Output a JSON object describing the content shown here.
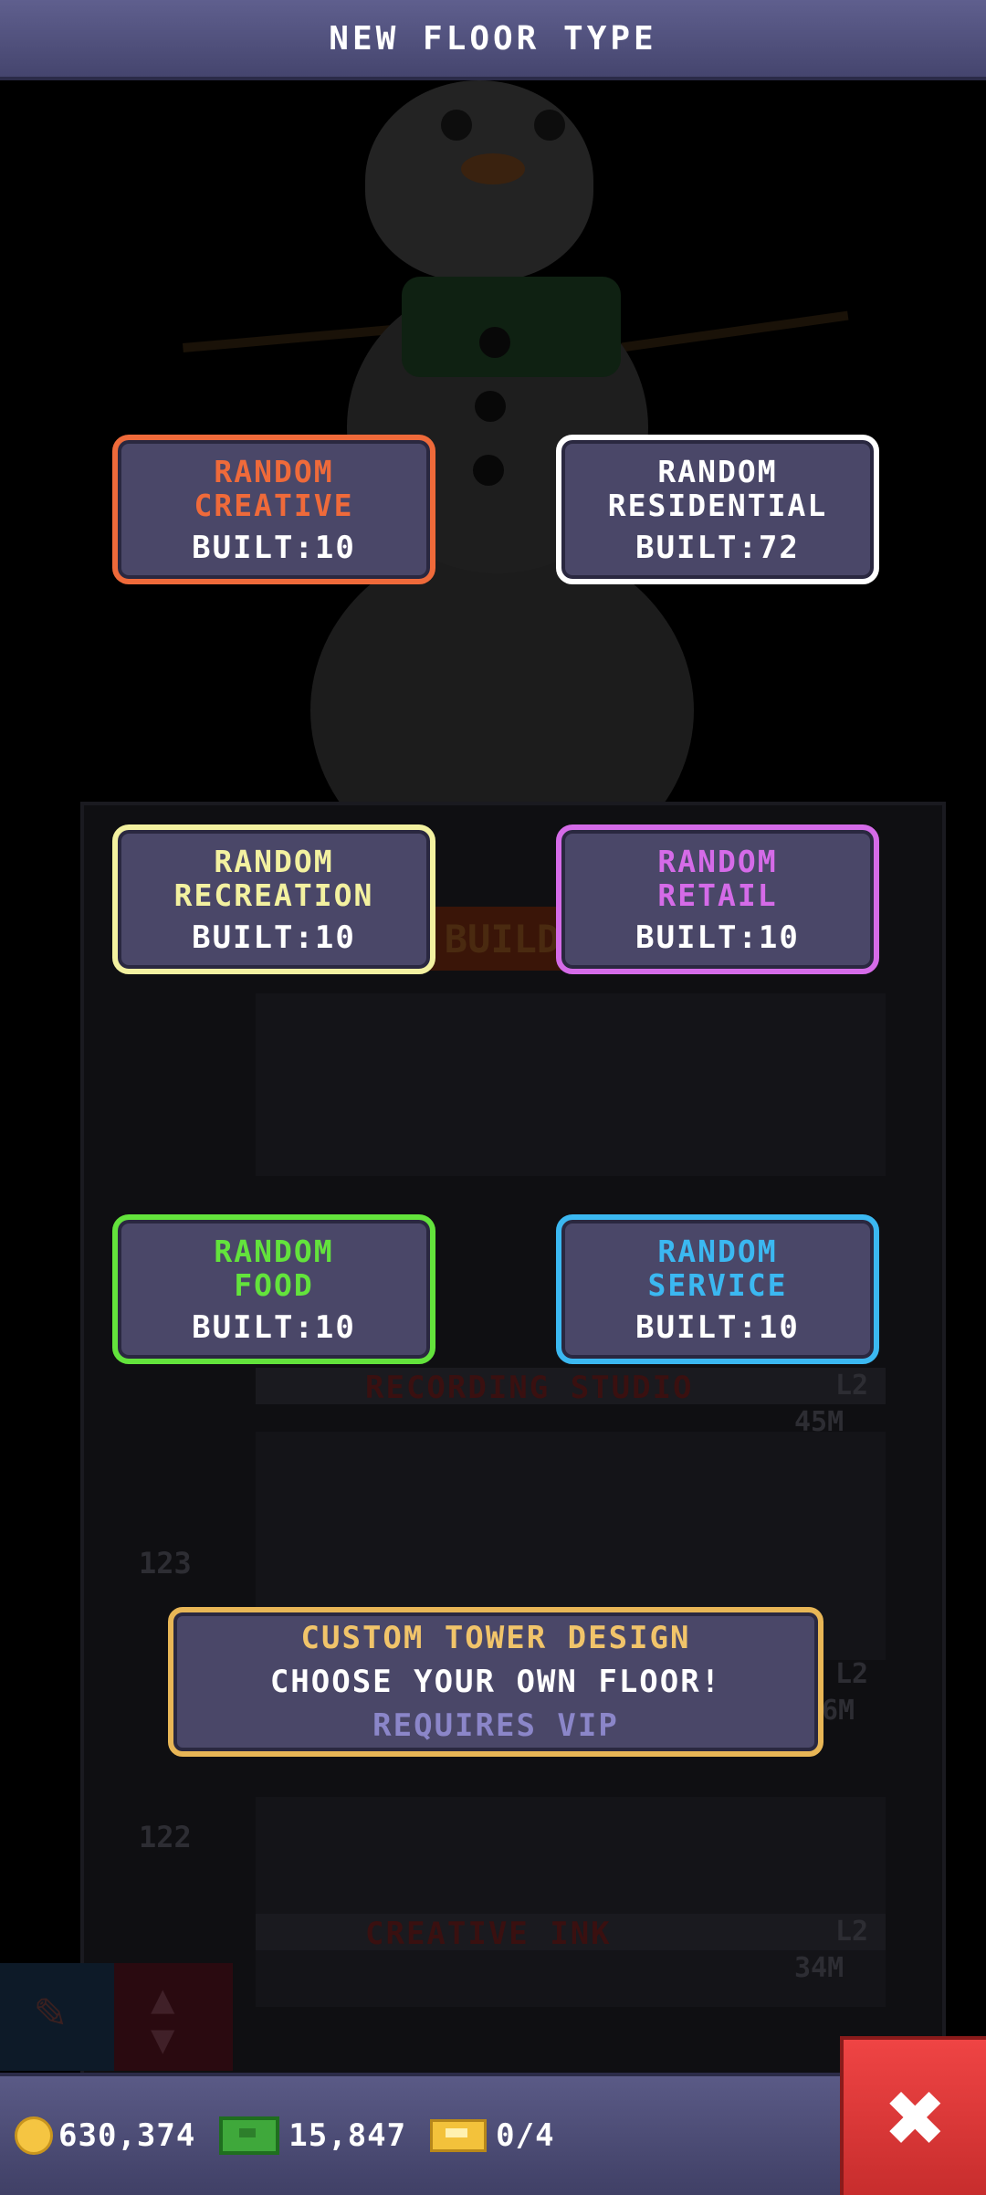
{
  "header": {
    "title": "NEW FLOOR TYPE"
  },
  "floor_types": [
    {
      "id": "creative",
      "name": "RANDOM\nCREATIVE",
      "built": "BUILT:10",
      "color": "#ef6a3a"
    },
    {
      "id": "residential",
      "name": "RANDOM\nRESIDENTIAL",
      "built": "BUILT:72",
      "color": "#ffffff"
    },
    {
      "id": "recreation",
      "name": "RANDOM\nRECREATION",
      "built": "BUILT:10",
      "color": "#f3f1a0"
    },
    {
      "id": "retail",
      "name": "RANDOM\nRETAIL",
      "built": "BUILT:10",
      "color": "#d56be8"
    },
    {
      "id": "food",
      "name": "RANDOM\nFOOD",
      "built": "BUILT:10",
      "color": "#63e33c"
    },
    {
      "id": "service",
      "name": "RANDOM\nSERVICE",
      "built": "BUILT:10",
      "color": "#3bb8f1"
    }
  ],
  "custom_design": {
    "title": "CUSTOM TOWER DESIGN",
    "subtitle": "CHOOSE YOUR OWN FLOOR!",
    "requirement": "REQUIRES VIP"
  },
  "background": {
    "build_sign": "BUILD",
    "floors": [
      {
        "name": "RECORDING STUDIO",
        "level": "L2",
        "value": "45M"
      },
      {
        "number": "123"
      },
      {
        "level": "L2",
        "value": "6M"
      },
      {
        "number": "122"
      },
      {
        "name": "CREATIVE INK",
        "level": "L2",
        "value": "34M"
      }
    ]
  },
  "status": {
    "coins": "630,374",
    "bux": "15,847",
    "tickets": "0/4"
  },
  "icons": {
    "coin": "coin-icon",
    "bux": "cash-icon",
    "ticket": "ticket-icon",
    "close": "close-icon"
  }
}
